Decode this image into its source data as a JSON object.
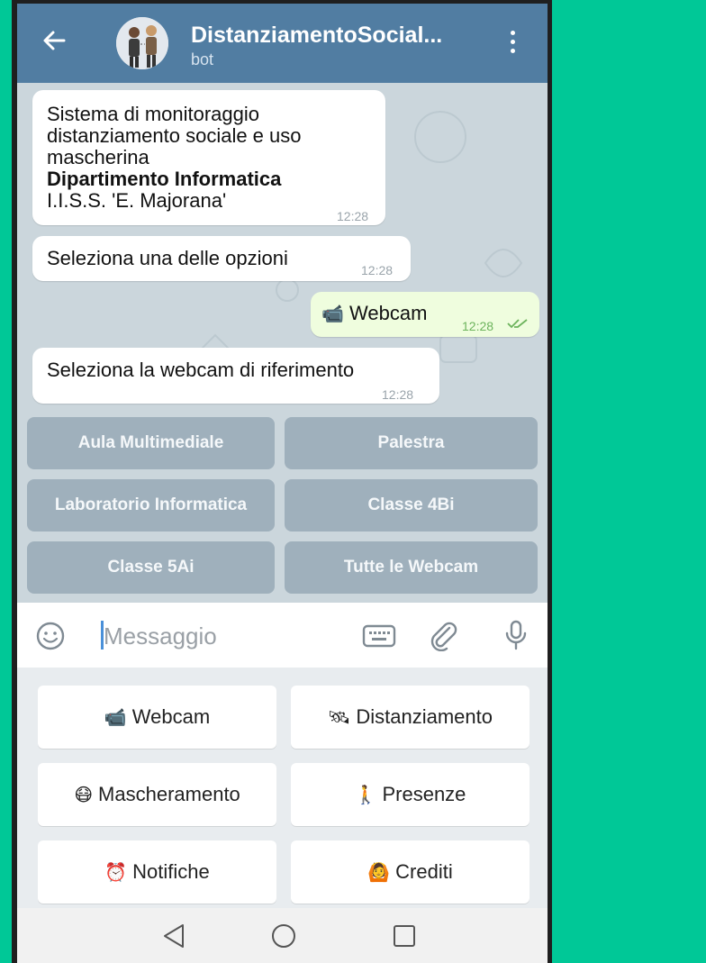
{
  "header": {
    "title": "DistanziamentoSocial...",
    "subtitle": "bot"
  },
  "messages": [
    {
      "lines": [
        "Sistema di monitoraggio",
        "distanziamento sociale e uso",
        "mascherina"
      ],
      "bold": "Dipartimento Informatica",
      "last": "I.I.S.S. 'E. Majorana'",
      "time": "12:28"
    },
    {
      "text": "Seleziona una delle opzioni",
      "time": "12:28"
    },
    {
      "emoji": "📹",
      "text": "Webcam",
      "time": "12:28",
      "status": "read"
    },
    {
      "text": "Seleziona la webcam di riferimento",
      "time": "12:28"
    }
  ],
  "inline_keyboard": [
    "Aula Multimediale",
    "Palestra",
    "Laboratorio Informatica",
    "Classe 4Bi",
    "Classe 5Ai",
    "Tutte le Webcam"
  ],
  "input": {
    "placeholder": "Messaggio"
  },
  "reply_keyboard": [
    {
      "emoji": "📹",
      "label": "Webcam"
    },
    {
      "emoji": "🛰",
      "label": "Distanziamento"
    },
    {
      "emoji": "😷",
      "label": "Mascheramento"
    },
    {
      "emoji": "🚶",
      "label": "Presenze"
    },
    {
      "emoji": "⏰",
      "label": "Notifiche"
    },
    {
      "emoji": "🙆",
      "label": "Crediti"
    }
  ],
  "colors": {
    "background": "#00c897",
    "header": "#517da2",
    "chat_bg": "#cbd6dc",
    "outgoing_bubble": "#effdde",
    "inline_button": "#9fb0bc",
    "read_check": "#6cb35c"
  }
}
